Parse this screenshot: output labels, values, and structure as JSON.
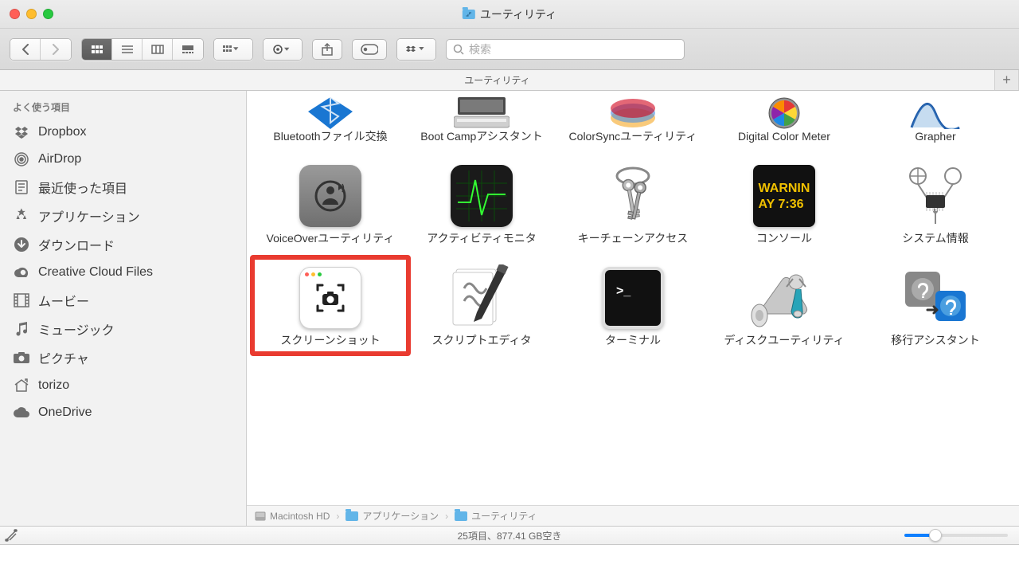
{
  "window": {
    "title": "ユーティリティ"
  },
  "tabs": [
    {
      "label": "ユーティリティ"
    }
  ],
  "search": {
    "placeholder": "検索"
  },
  "sidebar": {
    "section_label": "よく使う項目",
    "items": [
      {
        "label": "Dropbox",
        "icon": "dropbox"
      },
      {
        "label": "AirDrop",
        "icon": "airdrop"
      },
      {
        "label": "最近使った項目",
        "icon": "recents"
      },
      {
        "label": "アプリケーション",
        "icon": "apps"
      },
      {
        "label": "ダウンロード",
        "icon": "downloads"
      },
      {
        "label": "Creative Cloud Files",
        "icon": "cc"
      },
      {
        "label": "ムービー",
        "icon": "movies"
      },
      {
        "label": "ミュージック",
        "icon": "music"
      },
      {
        "label": "ピクチャ",
        "icon": "pictures"
      },
      {
        "label": "torizo",
        "icon": "home"
      },
      {
        "label": "OneDrive",
        "icon": "cloud"
      }
    ]
  },
  "items_row0": [
    {
      "label": "Bluetoothファイル交換"
    },
    {
      "label": "Boot Campアシスタント"
    },
    {
      "label": "ColorSyncユーティリティ"
    },
    {
      "label": "Digital Color Meter"
    },
    {
      "label": "Grapher"
    }
  ],
  "items_row1": [
    {
      "label": "VoiceOverユーティリティ"
    },
    {
      "label": "アクティビティモニタ"
    },
    {
      "label": "キーチェーンアクセス"
    },
    {
      "label": "コンソール",
      "console_line1": "WARNIN",
      "console_line2": "AY 7:36"
    },
    {
      "label": "システム情報"
    }
  ],
  "items_row2": [
    {
      "label": "スクリーンショット",
      "highlighted": true
    },
    {
      "label": "スクリプトエディタ"
    },
    {
      "label": "ターミナル"
    },
    {
      "label": "ディスクユーティリティ"
    },
    {
      "label": "移行アシスタント"
    }
  ],
  "path": [
    {
      "label": "Macintosh HD",
      "icon": "disk"
    },
    {
      "label": "アプリケーション",
      "icon": "folder"
    },
    {
      "label": "ユーティリティ",
      "icon": "folder"
    }
  ],
  "status": {
    "text": "25項目、877.41 GB空き"
  }
}
